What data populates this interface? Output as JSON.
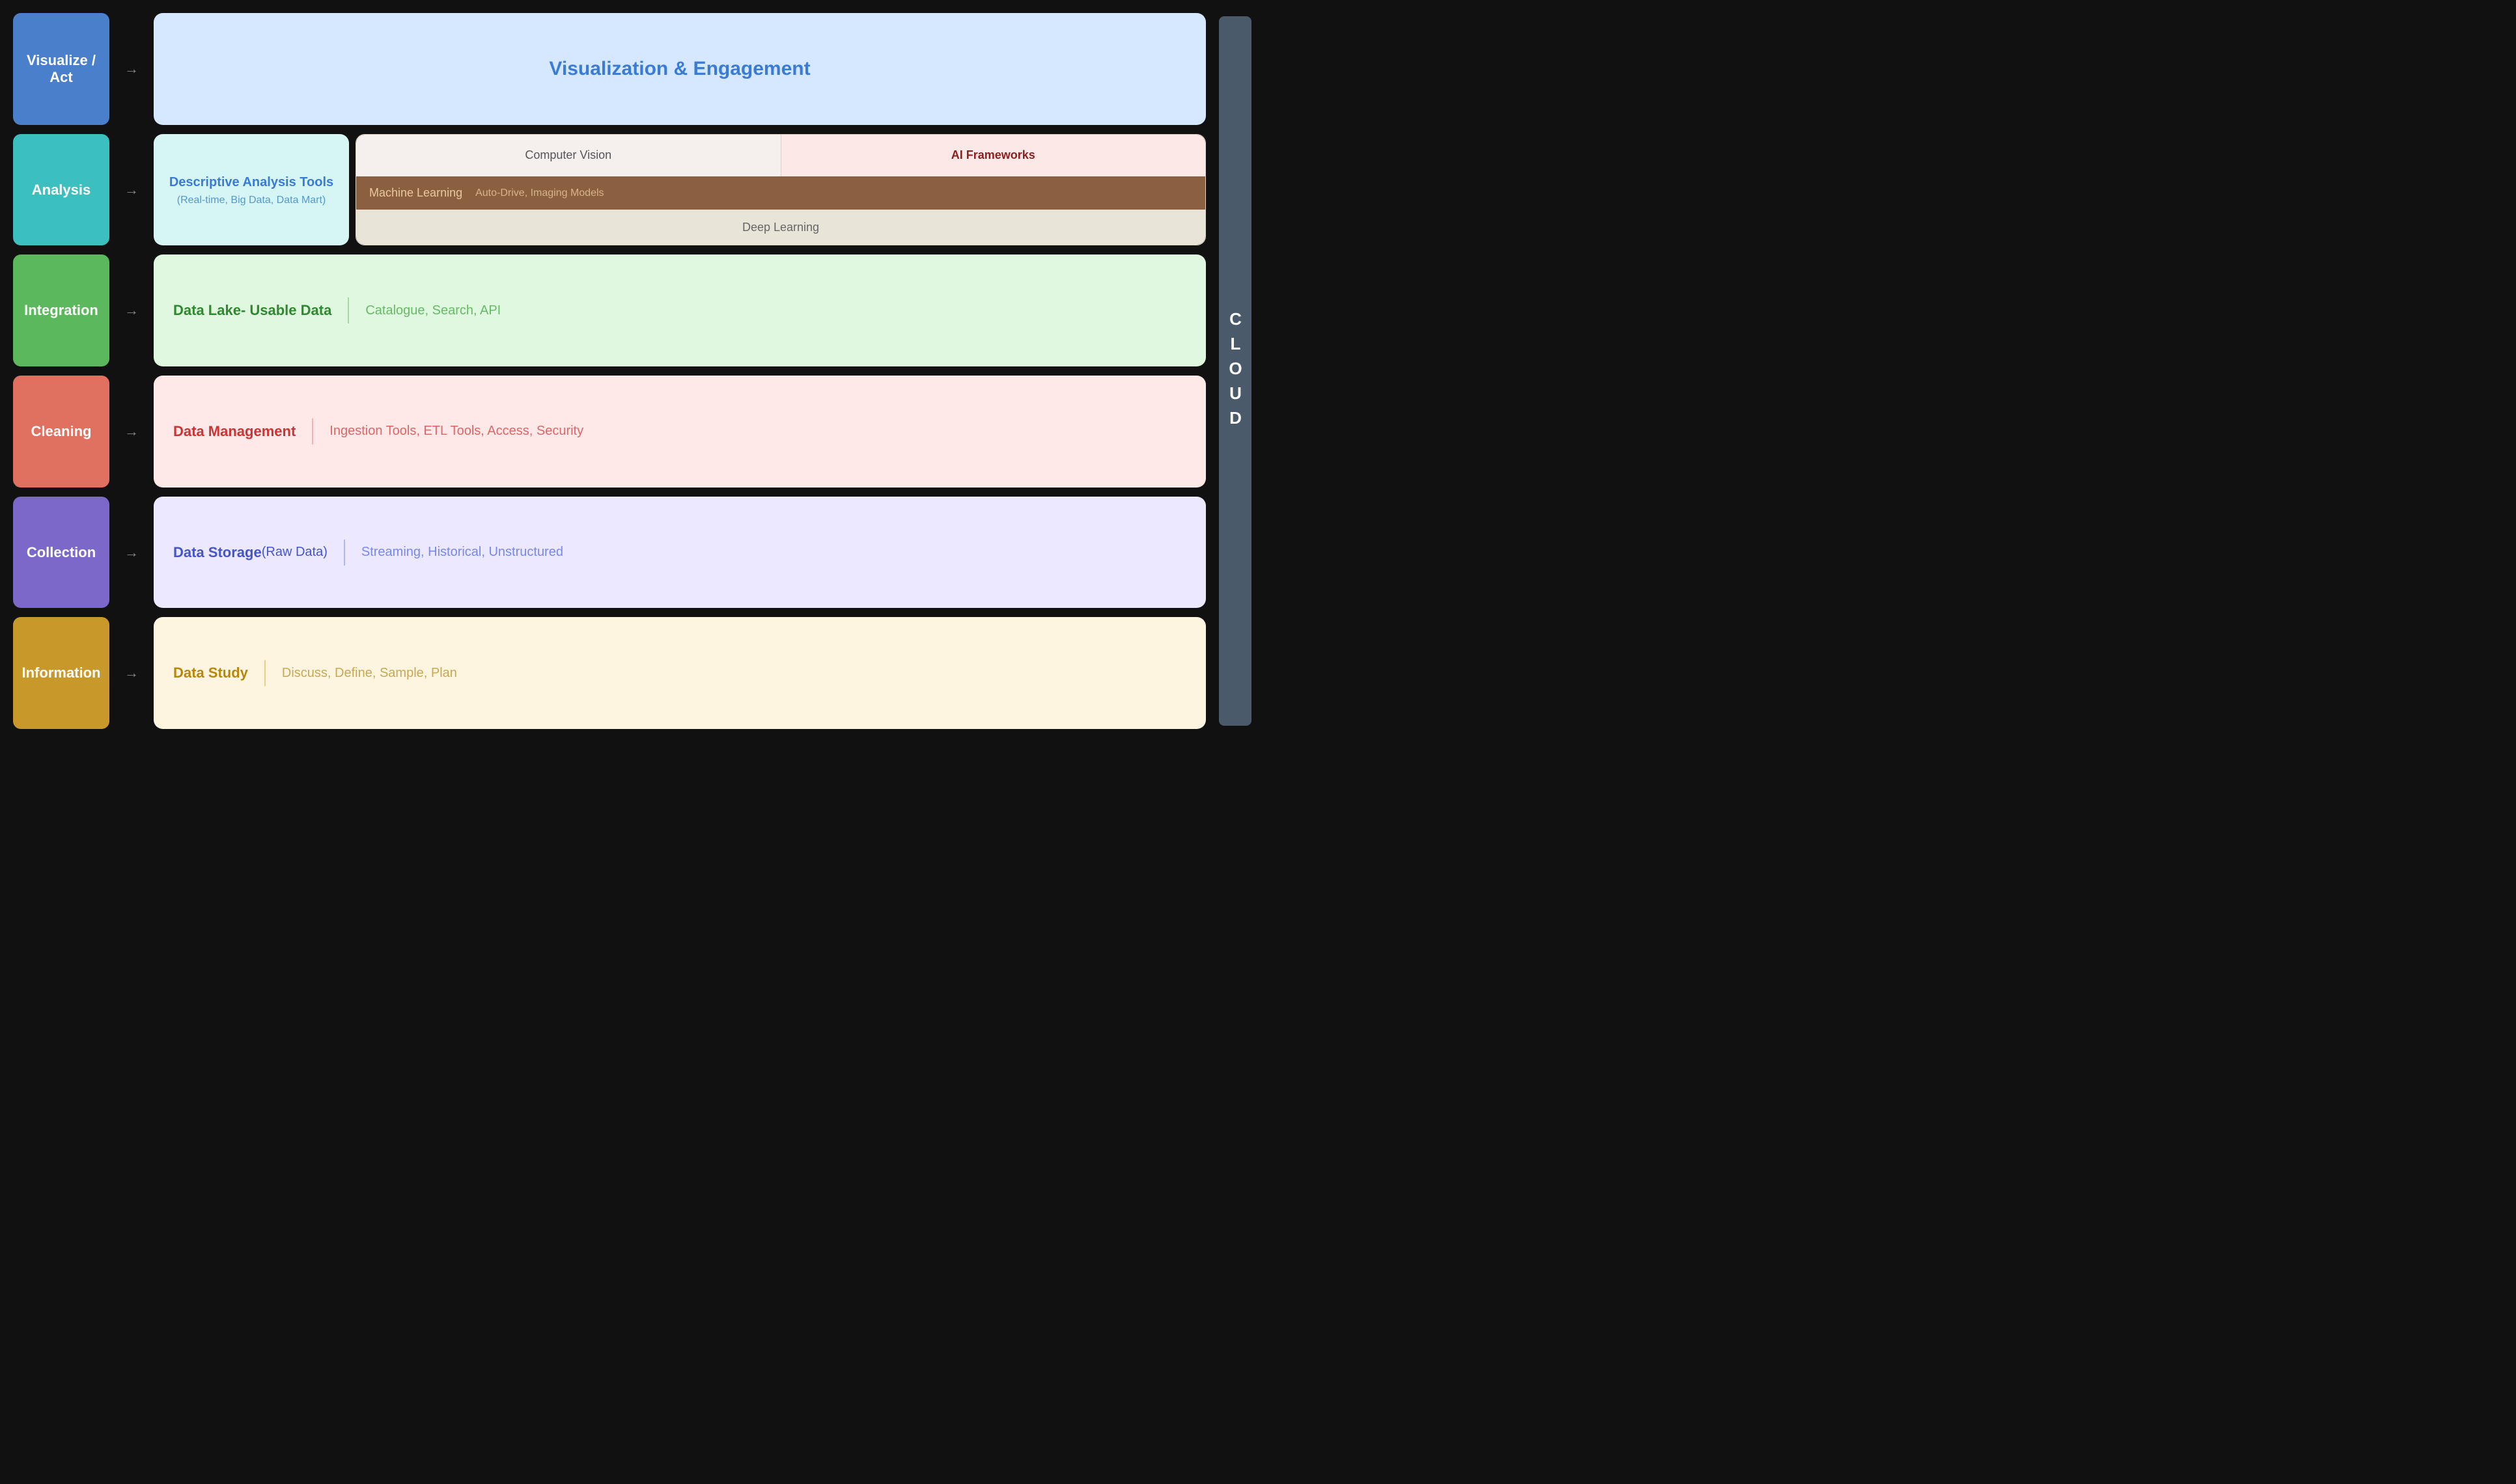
{
  "rows": {
    "visualize": {
      "label": "Visualize / Act",
      "arrow": "→",
      "content": {
        "main": "Visualization & Engagement"
      }
    },
    "analysis": {
      "label": "Analysis",
      "arrow": "→",
      "left": {
        "title": "Descriptive Analysis Tools",
        "subtitle": "(Real-time, Big Data, Data Mart)"
      },
      "right": {
        "cv": "Computer Vision",
        "af": "AI Frameworks",
        "ml": "Machine Learning",
        "ml_right": "Auto-Drive, Imaging Models",
        "dl": "Deep Learning"
      }
    },
    "integration": {
      "label": "Integration",
      "arrow": "→",
      "main": "Data Lake- Usable Data",
      "sub": "Catalogue, Search, API"
    },
    "cleaning": {
      "label": "Cleaning",
      "arrow": "→",
      "main": "Data Management",
      "sub": "Ingestion Tools, ETL Tools, Access, Security"
    },
    "collection": {
      "label": "Collection",
      "arrow": "→",
      "main": "Data Storage",
      "raw": " (Raw Data)",
      "sub": "Streaming, Historical, Unstructured"
    },
    "information": {
      "label": "Information",
      "arrow": "→",
      "main": "Data Study",
      "sub": "Discuss, Define, Sample, Plan"
    }
  },
  "cloud": {
    "text": "CLOUD"
  }
}
